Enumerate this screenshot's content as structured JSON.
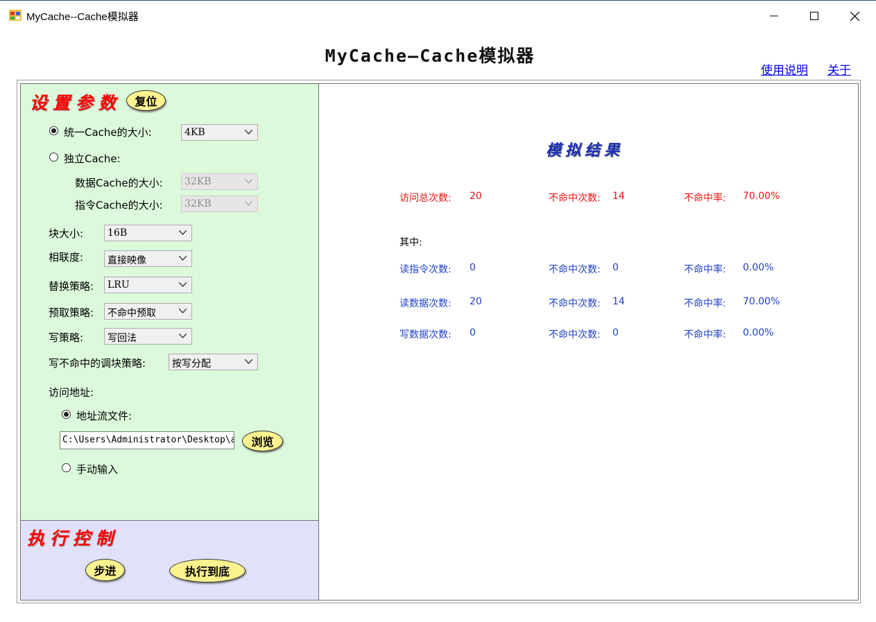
{
  "window": {
    "title": "MyCache--Cache模拟器"
  },
  "header": {
    "title": "MyCache—Cache模拟器",
    "help_link": "使用说明",
    "about_link": "关于"
  },
  "settings": {
    "section_title": "设置参数",
    "reset_button": "复位",
    "unified_cache_label": "统一Cache的大小:",
    "unified_cache_size": "4KB",
    "split_cache_label": "独立Cache:",
    "data_cache_label": "数据Cache的大小:",
    "data_cache_size": "32KB",
    "instr_cache_label": "指令Cache的大小:",
    "instr_cache_size": "32KB",
    "block_size_label": "块大小:",
    "block_size": "16B",
    "assoc_label": "相联度:",
    "assoc": "直接映像",
    "replace_label": "替换策略:",
    "replace": "LRU",
    "prefetch_label": "预取策略:",
    "prefetch": "不命中预取",
    "write_label": "写策略:",
    "write": "写回法",
    "write_miss_label": "写不命中的调块策略:",
    "write_miss": "按写分配",
    "address_label": "访问地址:",
    "file_radio_label": "地址流文件:",
    "file_path": "C:\\Users\\Administrator\\Desktop\\ac",
    "browse_button": "浏览",
    "manual_radio_label": "手动输入"
  },
  "exec": {
    "section_title": "执行控制",
    "step_button": "步进",
    "run_button": "执行到底"
  },
  "results": {
    "title": "模拟结果",
    "total_label": "访问总次数:",
    "total_value": "20",
    "total_miss_label": "不命中次数:",
    "total_miss_value": "14",
    "total_miss_rate_label": "不命中率:",
    "total_miss_rate": "70.00%",
    "breakdown_label": "其中:",
    "rows": [
      {
        "label": "读指令次数:",
        "value": "0",
        "miss_label": "不命中次数:",
        "miss": "0",
        "rate_label": "不命中率:",
        "rate": "0.00%"
      },
      {
        "label": "读数据次数:",
        "value": "20",
        "miss_label": "不命中次数:",
        "miss": "14",
        "rate_label": "不命中率:",
        "rate": "70.00%"
      },
      {
        "label": "写数据次数:",
        "value": "0",
        "miss_label": "不命中次数:",
        "miss": "0",
        "rate_label": "不命中率:",
        "rate": "0.00%"
      }
    ]
  },
  "icons": {
    "app": "app-window-icon",
    "minimize": "minimize-icon",
    "maximize": "maximize-icon",
    "close": "close-icon",
    "dropdown": "chevron-down-icon"
  },
  "colors": {
    "settings_bg": "#dcf9dc",
    "exec_bg": "#e1e1f9",
    "button_yellow": "#fbf38f",
    "red_text": "#ee1111",
    "blue_text": "#1c3fc7"
  }
}
